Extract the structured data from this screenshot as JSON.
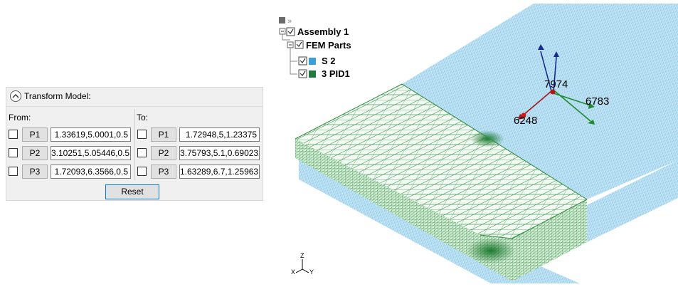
{
  "transform_panel": {
    "title": "Transform Model:",
    "from_label": "From:",
    "to_label": "To:",
    "from_rows": [
      {
        "button": "P1",
        "value": "1.33619,5.0001,0.5",
        "checked": false
      },
      {
        "button": "P2",
        "value": "3.10251,5.05446,0.5",
        "checked": false
      },
      {
        "button": "P3",
        "value": "1.72093,6.3566,0.5",
        "checked": false
      }
    ],
    "to_rows": [
      {
        "button": "P1",
        "value": "1.72948,5,1.23375",
        "checked": false
      },
      {
        "button": "P2",
        "value": "3.75793,5.1,0.69023",
        "checked": false
      },
      {
        "button": "P3",
        "value": "1.63289,6.7,1.25963",
        "checked": false
      }
    ],
    "reset_label": "Reset"
  },
  "model_tree": {
    "nodes": [
      {
        "label": "Assembly 1",
        "checked": true
      },
      {
        "label": "FEM Parts",
        "checked": true
      },
      {
        "label": "S 2",
        "checked": true,
        "color": "#3aa0dc"
      },
      {
        "label": "3 PID1",
        "checked": true,
        "color": "#1f7a3e"
      }
    ]
  },
  "viewport": {
    "node_labels": {
      "top": "7974",
      "right": "6783",
      "left": "6248"
    },
    "axis_triad": {
      "z": "Z",
      "x": "X",
      "y": "Y"
    },
    "colors": {
      "shell_mesh": "#8ec8e8",
      "shell_fill": "#bfe3f5",
      "solid_mesh": "#2e8b3e",
      "solid_fill": "#e9f4ea"
    }
  }
}
